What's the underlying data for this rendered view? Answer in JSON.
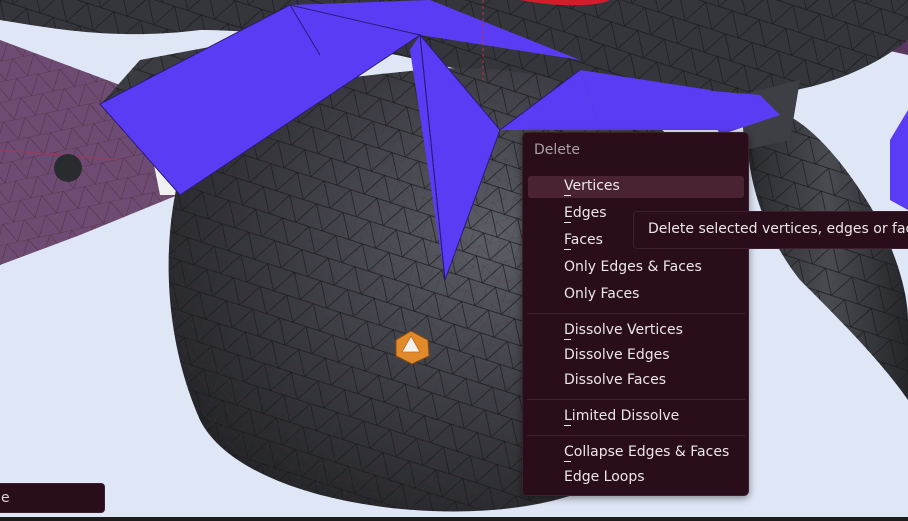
{
  "menu": {
    "title": "Delete",
    "items": [
      {
        "label": "Vertices",
        "active": true
      },
      {
        "label": "Edges"
      },
      {
        "label": "Faces"
      },
      {
        "label": "Only Edges & Faces"
      },
      {
        "label": "Only Faces"
      },
      {
        "label": "Dissolve Vertices"
      },
      {
        "label": "Dissolve Edges"
      },
      {
        "label": "Dissolve Faces"
      },
      {
        "label": "Limited Dissolve"
      },
      {
        "label": "Collapse Edges & Faces"
      },
      {
        "label": "Edge Loops"
      }
    ]
  },
  "tooltip": {
    "text": "Delete selected vertices, edges or faces:"
  },
  "status": {
    "fragment": "e"
  },
  "colors": {
    "menu_bg": "#2a0d1a",
    "menu_item_highlight": "#4a2333",
    "selected_faces": "#5b3cf5",
    "mesh": "#3e3e44",
    "background": "#dfe6f5",
    "object_origin": "#e08a2c"
  }
}
